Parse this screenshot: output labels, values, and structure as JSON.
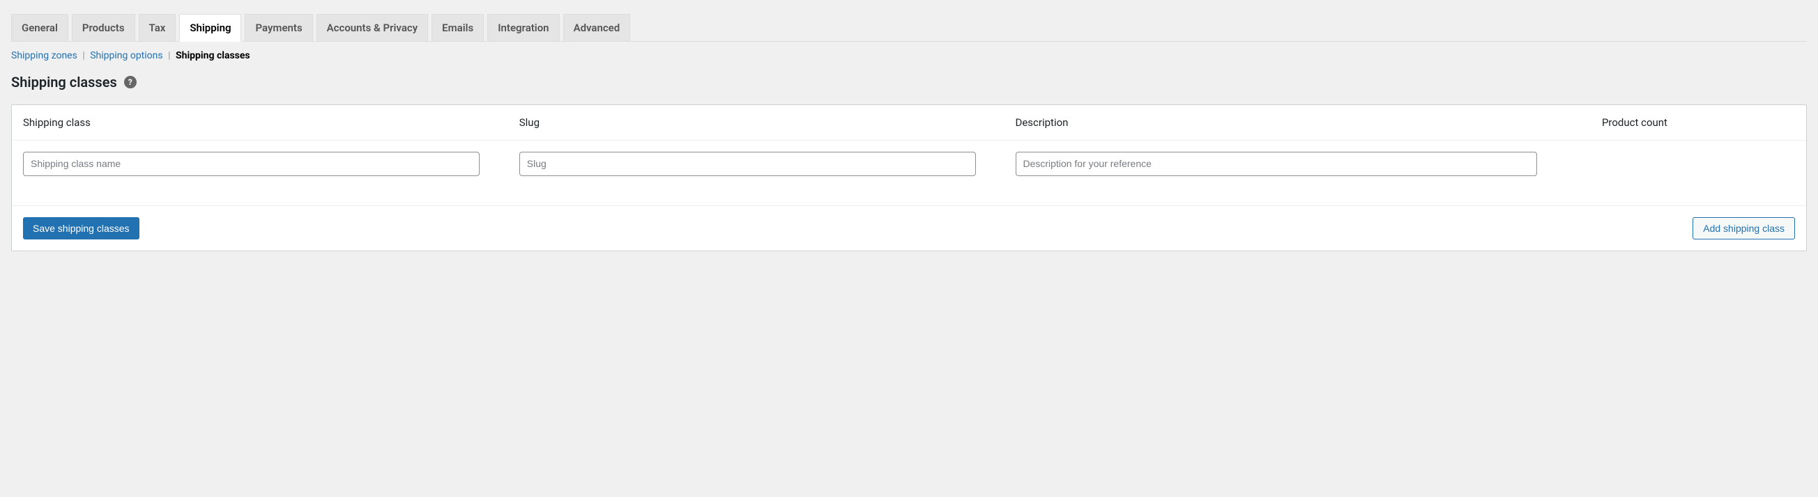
{
  "tabs": {
    "general": "General",
    "products": "Products",
    "tax": "Tax",
    "shipping": "Shipping",
    "payments": "Payments",
    "accounts": "Accounts & Privacy",
    "emails": "Emails",
    "integration": "Integration",
    "advanced": "Advanced"
  },
  "subnav": {
    "zones": "Shipping zones",
    "options": "Shipping options",
    "classes": "Shipping classes"
  },
  "page_title": "Shipping classes",
  "help_icon": "?",
  "columns": {
    "name": "Shipping class",
    "slug": "Slug",
    "description": "Description",
    "count": "Product count"
  },
  "placeholders": {
    "name": "Shipping class name",
    "slug": "Slug",
    "description": "Description for your reference"
  },
  "buttons": {
    "save": "Save shipping classes",
    "add": "Add shipping class"
  }
}
